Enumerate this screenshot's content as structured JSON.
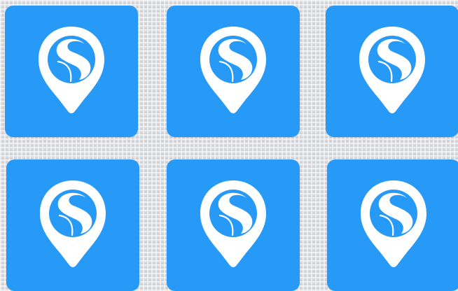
{
  "colors": {
    "tile_background": "#2799f6",
    "icon_foreground": "#ffffff"
  },
  "icons": [
    {
      "name": "location-pin-s-logo-icon"
    },
    {
      "name": "location-pin-s-logo-icon"
    },
    {
      "name": "location-pin-s-logo-icon"
    },
    {
      "name": "location-pin-s-logo-icon"
    },
    {
      "name": "location-pin-s-logo-icon"
    },
    {
      "name": "location-pin-s-logo-icon"
    }
  ]
}
